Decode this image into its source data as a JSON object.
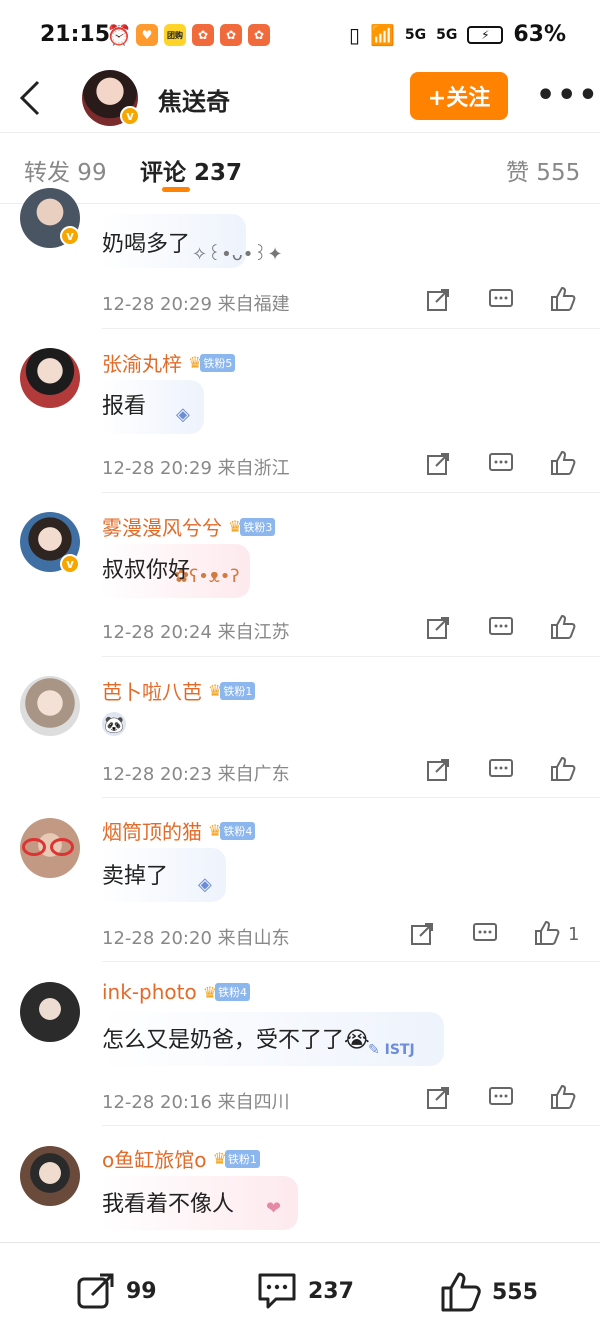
{
  "status": {
    "time": "21:15",
    "battery_pct": "63%",
    "signal1": "5G",
    "signal2": "5G",
    "yellow_app": "团购"
  },
  "header": {
    "back_icon": "chevron-left-icon",
    "name": "焦送奇",
    "follow_label": "+关注",
    "more_label": "•••"
  },
  "tabs": [
    {
      "label": "转发 99"
    },
    {
      "label": "评论 237"
    },
    {
      "label": "赞 555"
    }
  ],
  "comments": [
    {
      "name": "",
      "text": "奶喝多了",
      "time": "12-28 20:29",
      "loc": "来自福建",
      "likes": "",
      "avatar_color": "#4a5563"
    },
    {
      "name": "张渝丸梓",
      "fan": "铁粉5",
      "text": "报看",
      "time": "12-28 20:29",
      "loc": "来自浙江",
      "likes": "",
      "avatar_color": "#b23a3a"
    },
    {
      "name": "雾漫漫风兮兮",
      "fan": "铁粉3",
      "text": "叔叔你好",
      "time": "12-28 20:24",
      "loc": "来自江苏",
      "likes": "",
      "avatar_color": "#3f6fa3"
    },
    {
      "name": "芭卜啦八芭",
      "fan": "铁粉1",
      "text": "",
      "time": "12-28 20:23",
      "loc": "来自广东",
      "likes": "",
      "avatar_color": "#a89585"
    },
    {
      "name": "烟筒顶的猫",
      "fan": "铁粉4",
      "text": "卖掉了",
      "time": "12-28 20:20",
      "loc": "来自山东",
      "likes": "1",
      "avatar_color": "#c29a83"
    },
    {
      "name": "ink-photo",
      "fan": "铁粉4",
      "text": "怎么又是奶爸，受不了了😭",
      "time": "12-28 20:16",
      "loc": "来自四川",
      "likes": "",
      "avatar_color": "#2b2b2b"
    },
    {
      "name": "o鱼缸旅馆o",
      "fan": "铁粉1",
      "text": "我看着不像人",
      "time": "",
      "loc": "",
      "likes": "",
      "avatar_color": "#6a4a3a"
    }
  ],
  "bottom": {
    "repost_count": "99",
    "comment_count": "237",
    "like_count": "555"
  }
}
